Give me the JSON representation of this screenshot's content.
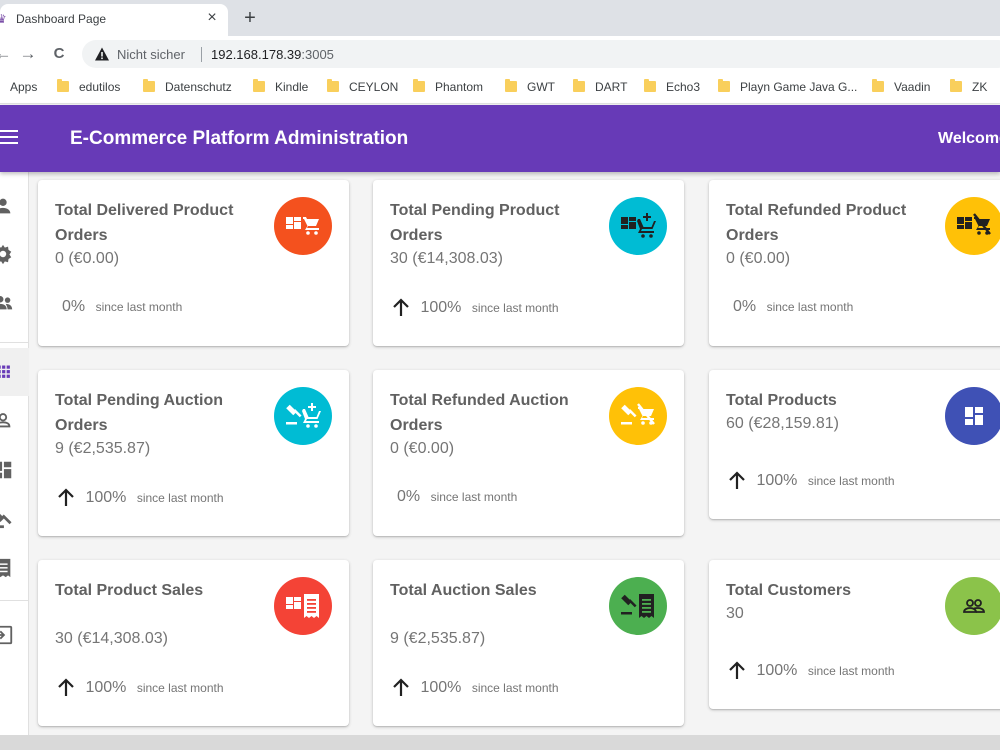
{
  "browser": {
    "tab_title": "Dashboard Page",
    "tab_close": "×",
    "new_tab": "+",
    "back": "←",
    "forward": "→",
    "reload": "C",
    "security_label": "Nicht sicher",
    "url_host": "192.168.178.39",
    "url_port": ":3005",
    "bookmarks": [
      "Apps",
      "edutilos",
      "Datenschutz",
      "Kindle",
      "CEYLON",
      "Phantom",
      "GWT",
      "DART",
      "Echo3",
      "Playn Game Java G...",
      "Vaadin",
      "ZK"
    ]
  },
  "appbar": {
    "title": "E-Commerce Platform Administration",
    "welcome": "Welcome"
  },
  "sidebar": {
    "items": [
      {
        "icon": "person-icon"
      },
      {
        "icon": "gear-icon"
      },
      {
        "icon": "people-icon"
      },
      {
        "icon": "grid-icon",
        "active": true
      },
      {
        "icon": "user-outline-icon"
      },
      {
        "icon": "dashboard-icon"
      },
      {
        "icon": "gavel-icon"
      },
      {
        "icon": "receipt-icon"
      },
      {
        "icon": "logout-icon"
      }
    ]
  },
  "cards": [
    {
      "title": "Total Delivered Product Orders",
      "value": "0 (€0.00)",
      "percent": "0%",
      "since": "since last month",
      "up": false,
      "icon": "product-cart-icon",
      "color": "#f4511e"
    },
    {
      "title": "Total Pending Product Orders",
      "value": "30 (€14,308.03)",
      "percent": "100%",
      "since": "since last month",
      "up": true,
      "icon": "product-cart-add-icon",
      "color": "#00bcd4"
    },
    {
      "title": "Total Refunded Product Orders",
      "value": "0 (€0.00)",
      "percent": "0%",
      "since": "since last month",
      "up": false,
      "icon": "product-cart-off-icon",
      "color": "#ffc107"
    },
    {
      "title": "Total Pending Auction Orders",
      "value": "9 (€2,535.87)",
      "percent": "100%",
      "since": "since last month",
      "up": true,
      "icon": "gavel-cart-add-icon",
      "color": "#00bcd4"
    },
    {
      "title": "Total Refunded Auction Orders",
      "value": "0 (€0.00)",
      "percent": "0%",
      "since": "since last month",
      "up": false,
      "icon": "gavel-cart-off-icon",
      "color": "#ffc107"
    },
    {
      "title": "Total Products",
      "value": "60 (€28,159.81)",
      "percent": "100%",
      "since": "since last month",
      "up": true,
      "icon": "dashboard-icon",
      "color": "#3f51b5"
    },
    {
      "title": "Total Product Sales",
      "value": "30 (€14,308.03)",
      "percent": "100%",
      "since": "since last month",
      "up": true,
      "icon": "product-receipt-icon",
      "color": "#f44336"
    },
    {
      "title": "Total Auction Sales",
      "value": "9 (€2,535.87)",
      "percent": "100%",
      "since": "since last month",
      "up": true,
      "icon": "gavel-receipt-icon",
      "color": "#4caf50"
    },
    {
      "title": "Total Customers",
      "value": "30",
      "percent": "100%",
      "since": "since last month",
      "up": true,
      "icon": "people-icon",
      "color": "#8bc34a"
    }
  ]
}
